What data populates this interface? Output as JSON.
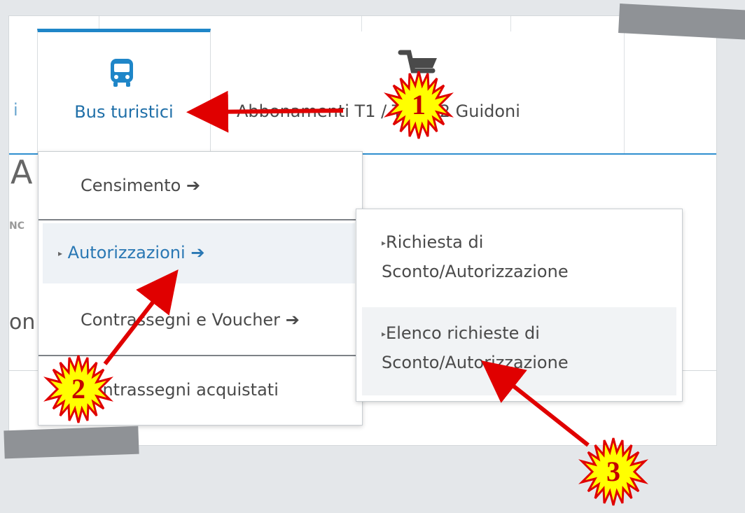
{
  "tabs": {
    "active_label": "Bus turistici",
    "second_label": "Abbonamenti T1 / T2 / T2 Guidoni",
    "partial_left": "i"
  },
  "background_fragments": {
    "heading_char": "A",
    "caps_fragment": "NC",
    "text_fragment": "on"
  },
  "menu": {
    "items": [
      {
        "label": "Censimento",
        "arrow": "➔"
      },
      {
        "label": "Autorizzazioni",
        "arrow": "➔",
        "caret": "▸"
      },
      {
        "label": "Contrassegni e Voucher",
        "arrow": "➔"
      },
      {
        "label": "Contrassegni acquistati"
      }
    ]
  },
  "submenu": {
    "caret": "▸",
    "items": [
      {
        "line1": "Richiesta di",
        "line2": "Sconto/Autorizzazione"
      },
      {
        "line1": "Elenco richieste di",
        "line2": "Sconto/Autorizzazione"
      }
    ]
  },
  "callouts": [
    "1",
    "2",
    "3"
  ],
  "colors": {
    "accent": "#1f86c8",
    "callout_red": "#e00000",
    "callout_fill": "#ffff00"
  },
  "icons": {
    "tab_bus": "bus-icon",
    "tab_cart": "cart-icon"
  }
}
